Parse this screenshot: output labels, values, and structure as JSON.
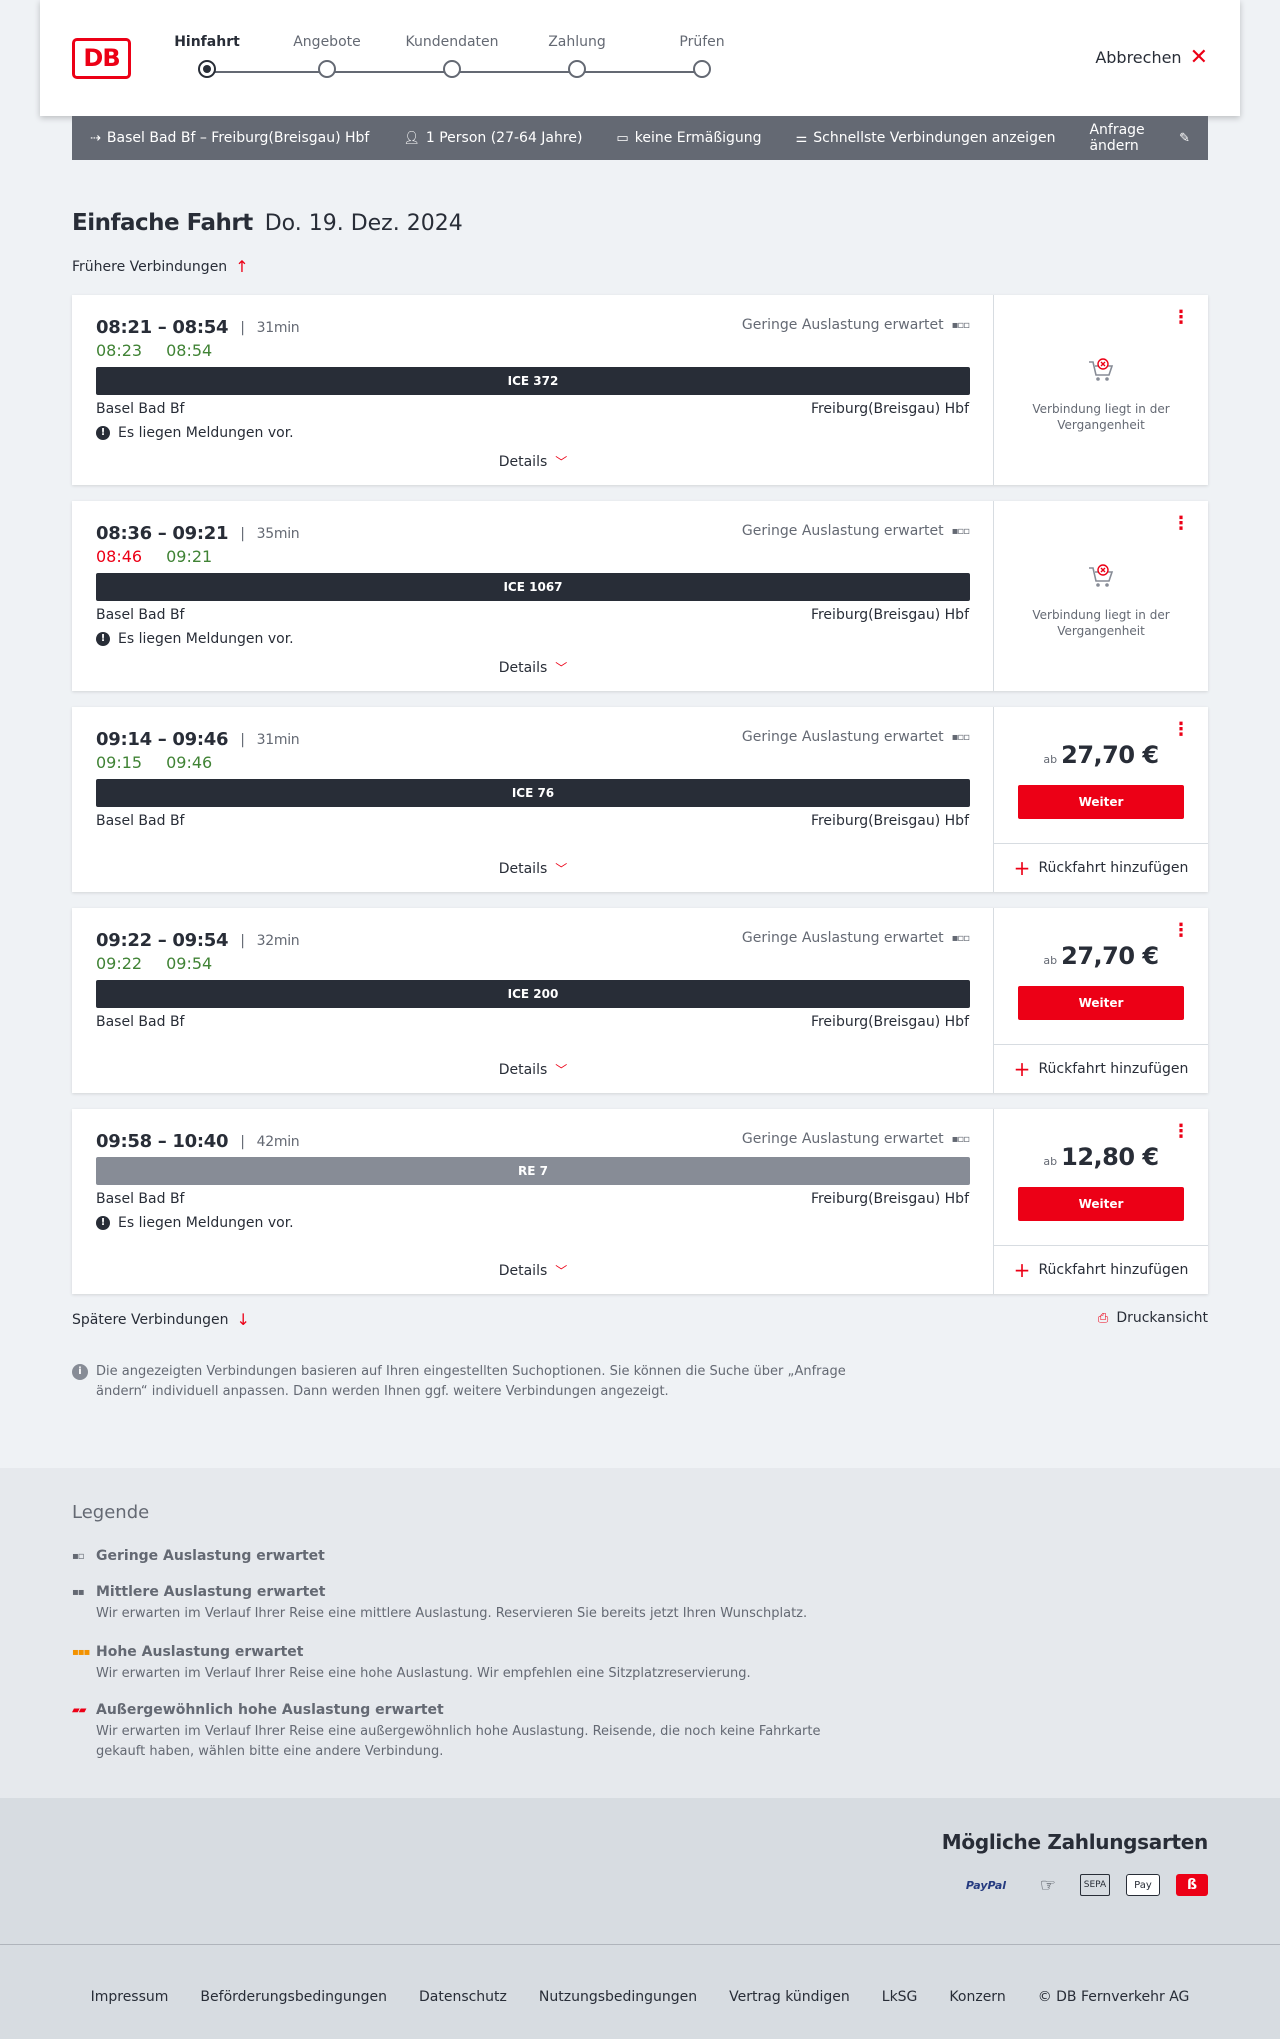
{
  "header": {
    "logo": "DB",
    "steps": [
      "Hinfahrt",
      "Angebote",
      "Kundendaten",
      "Zahlung",
      "Prüfen"
    ],
    "active_step": "Hinfahrt",
    "cancel_label": "Abbrechen"
  },
  "search": {
    "route": "Basel Bad Bf – Freiburg(Breisgau) Hbf",
    "travellers": "1 Person (27-64 Jahre)",
    "discount": "keine Ermäßigung",
    "option": "Schnellste Verbindungen anzeigen",
    "change_label": "Anfrage ändern"
  },
  "title": {
    "main": "Einfache Fahrt",
    "date": "Do. 19. Dez. 2024"
  },
  "earlier_label": "Frühere Verbindungen",
  "later_label": "Spätere Verbindungen",
  "print_label": "Druckansicht",
  "connections": [
    {
      "times": "08:21 – 08:54",
      "duration": "31min",
      "rt_dep": "08:23",
      "rt_arr": "08:54",
      "rt_dep_late": false,
      "load": "Geringe Auslastung erwartet",
      "train": "ICE 372",
      "from": "Basel Bad Bf",
      "to": "Freiburg(Breisgau) Hbf",
      "message": "Es liegen Meldungen vor.",
      "details_label": "Details",
      "past_text": "Verbindung liegt in der Vergangenheit"
    },
    {
      "times": "08:36 – 09:21",
      "duration": "35min",
      "rt_dep": "08:46",
      "rt_arr": "09:21",
      "rt_dep_late": true,
      "load": "Geringe Auslastung erwartet",
      "train": "ICE 1067",
      "from": "Basel Bad Bf",
      "to": "Freiburg(Breisgau) Hbf",
      "message": "Es liegen Meldungen vor.",
      "details_label": "Details",
      "past_text": "Verbindung liegt in der Vergangenheit"
    },
    {
      "times": "09:14 – 09:46",
      "duration": "31min",
      "rt_dep": "09:15",
      "rt_arr": "09:46",
      "rt_dep_late": false,
      "load": "Geringe Auslastung erwartet",
      "train": "ICE 76",
      "from": "Basel Bad Bf",
      "to": "Freiburg(Breisgau) Hbf",
      "details_label": "Details",
      "price_prefix": "ab",
      "price": "27,70 €",
      "button": "Weiter",
      "return_label": "Rückfahrt hinzufügen"
    },
    {
      "times": "09:22 – 09:54",
      "duration": "32min",
      "rt_dep": "09:22",
      "rt_arr": "09:54",
      "rt_dep_late": false,
      "load": "Geringe Auslastung erwartet",
      "train": "ICE 200",
      "from": "Basel Bad Bf",
      "to": "Freiburg(Breisgau) Hbf",
      "details_label": "Details",
      "price_prefix": "ab",
      "price": "27,70 €",
      "button": "Weiter",
      "return_label": "Rückfahrt hinzufügen"
    },
    {
      "times": "09:58 – 10:40",
      "duration": "42min",
      "load": "Geringe Auslastung erwartet",
      "train": "RE 7",
      "from": "Basel Bad Bf",
      "to": "Freiburg(Breisgau) Hbf",
      "message": "Es liegen Meldungen vor.",
      "details_label": "Details",
      "price_prefix": "ab",
      "price": "12,80 €",
      "button": "Weiter",
      "return_label": "Rückfahrt hinzufügen"
    }
  ],
  "note": "Die angezeigten Verbindungen basieren auf Ihren eingestellten Suchoptionen. Sie können die Suche über „Anfrage ändern“ individuell anpassen. Dann werden Ihnen ggf. weitere Verbindungen angezeigt.",
  "legend": {
    "title": "Legende",
    "items": [
      {
        "title": "Geringe Auslastung erwartet",
        "text": ""
      },
      {
        "title": "Mittlere Auslastung erwartet",
        "text": "Wir erwarten im Verlauf Ihrer Reise eine mittlere Auslastung. Reservieren Sie bereits jetzt Ihren Wunschplatz."
      },
      {
        "title": "Hohe Auslastung erwartet",
        "text": "Wir erwarten im Verlauf Ihrer Reise eine hohe Auslastung. Wir empfehlen eine Sitzplatzreservierung."
      },
      {
        "title": "Außergewöhnlich hohe Auslastung erwartet",
        "text": "Wir erwarten im Verlauf Ihrer Reise eine außergewöhnlich hohe Auslastung. Reisende, die noch keine Fahrkarte gekauft haben, wählen bitte eine andere Verbindung."
      }
    ]
  },
  "payment": {
    "title": "Mögliche Zahlungsarten",
    "methods": {
      "paypal": "PayPal",
      "sepa": "SEPA",
      "apple": "Pay"
    }
  },
  "footer": {
    "links": [
      "Impressum",
      "Beförderungsbedingungen",
      "Datenschutz",
      "Nutzungsbedingungen",
      "Vertrag kündigen",
      "LkSG",
      "Konzern",
      "© DB Fernverkehr AG"
    ]
  },
  "colors": {
    "brand_red": "#ec0016",
    "realtime_green": "#408335",
    "dark": "#282d37",
    "grey": "#646973"
  }
}
